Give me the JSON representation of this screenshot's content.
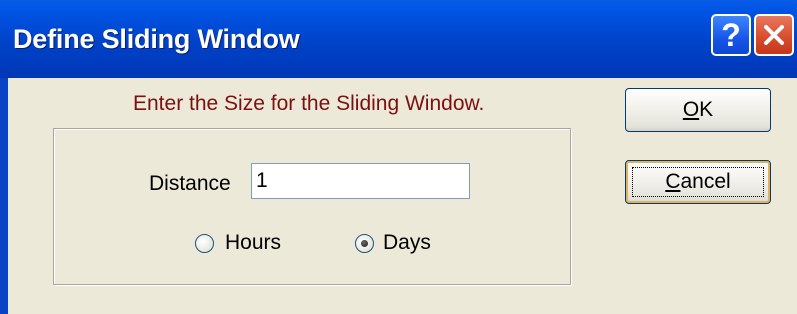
{
  "window": {
    "title": "Define Sliding Window",
    "help_glyph": "?",
    "close_icon": "close-icon"
  },
  "dialog": {
    "prompt": "Enter the Size for the Sliding Window.",
    "distance_label": "Distance",
    "distance_value": "1",
    "unit_options": [
      "Hours",
      "Days"
    ],
    "selected_unit": "Days"
  },
  "buttons": {
    "ok_mnemonic": "O",
    "ok_rest": "K",
    "cancel_mnemonic": "C",
    "cancel_rest": "ancel"
  },
  "colors": {
    "titlebar": "#0042c9",
    "dialog_bg": "#ece9d8",
    "prompt_text": "#7b1010",
    "close_button": "#d84a2a"
  }
}
